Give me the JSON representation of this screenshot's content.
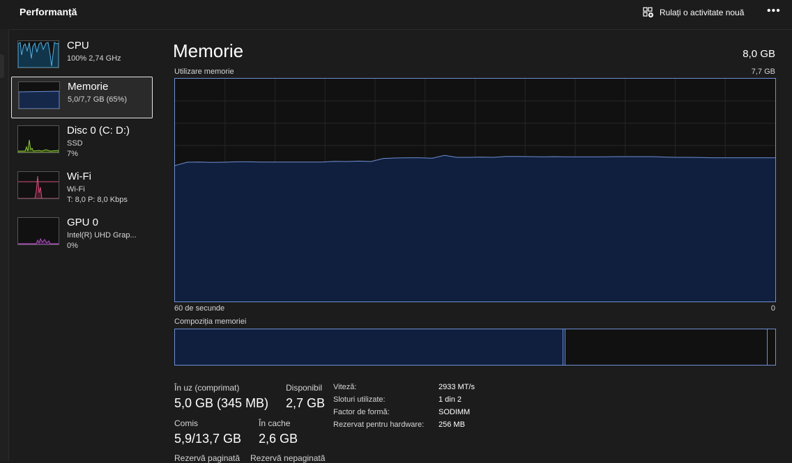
{
  "header": {
    "title": "Performanță",
    "new_task_label": "Rulați o activitate nouă",
    "more_label": "•••"
  },
  "sidebar": {
    "items": [
      {
        "title": "CPU",
        "sub1": "100%  2,74 GHz",
        "sub2": "",
        "color": "#4fb3e8"
      },
      {
        "title": "Memorie",
        "sub1": "5,0/7,7 GB (65%)",
        "sub2": "",
        "color": "#6f8fd6"
      },
      {
        "title": "Disc 0 (C: D:)",
        "sub1": "SSD",
        "sub2": "7%",
        "color": "#8ec73b"
      },
      {
        "title": "Wi-Fi",
        "sub1": "Wi-Fi",
        "sub2": "T: 8,0  P: 8,0 Kbps",
        "color": "#d84d7d"
      },
      {
        "title": "GPU 0",
        "sub1": "Intel(R) UHD Grap...",
        "sub2": "0%",
        "color": "#b04dbf"
      }
    ]
  },
  "main": {
    "title": "Memorie",
    "total": "8,0 GB",
    "usage_label": "Utilizare memorie",
    "usage_max": "7,7 GB",
    "time_left": "60 de secunde",
    "time_right": "0",
    "composition_label": "Compoziția memoriei"
  },
  "stats": {
    "in_use_label": "În uz (comprimat)",
    "in_use_value": "5,0 GB (345 MB)",
    "available_label": "Disponibil",
    "available_value": "2,7 GB",
    "committed_label": "Comis",
    "committed_value": "5,9/13,7 GB",
    "cached_label": "În cache",
    "cached_value": "2,6 GB",
    "paged_label": "Rezervă paginată",
    "nonpaged_label": "Rezervă nepaginată"
  },
  "details": [
    {
      "key": "Viteză:",
      "value": "2933 MT/s"
    },
    {
      "key": "Sloturi utilizate:",
      "value": "1 din 2"
    },
    {
      "key": "Factor de formă:",
      "value": "SODIMM"
    },
    {
      "key": "Rezervat pentru hardware:",
      "value": "256 MB"
    }
  ],
  "chart_data": {
    "type": "area",
    "x_range_seconds": [
      60,
      0
    ],
    "y_range_gb": [
      0,
      7.7
    ],
    "grid": true,
    "values_percent": [
      61,
      62.5,
      62.6,
      62.4,
      62.5,
      62.7,
      62.7,
      62.6,
      62.6,
      62.6,
      62.6,
      62.6,
      62.6,
      62.9,
      62.8,
      63,
      62.8,
      64.2,
      64.4,
      64.5,
      64.5,
      64.3,
      65.6,
      64.7,
      64.7,
      64.8,
      64.7,
      65.1,
      65.1,
      65,
      64.9,
      65,
      64.9,
      64.9,
      64.9,
      64.9,
      65,
      65,
      65,
      65,
      64.8,
      64.7,
      64.7,
      64.6,
      64.5,
      64.5,
      64.5,
      64.5,
      64.5,
      64.5
    ],
    "composition_gb": {
      "in_use": 5.0,
      "modified": 0.03,
      "standby": 2.6,
      "free": 0.1
    }
  }
}
